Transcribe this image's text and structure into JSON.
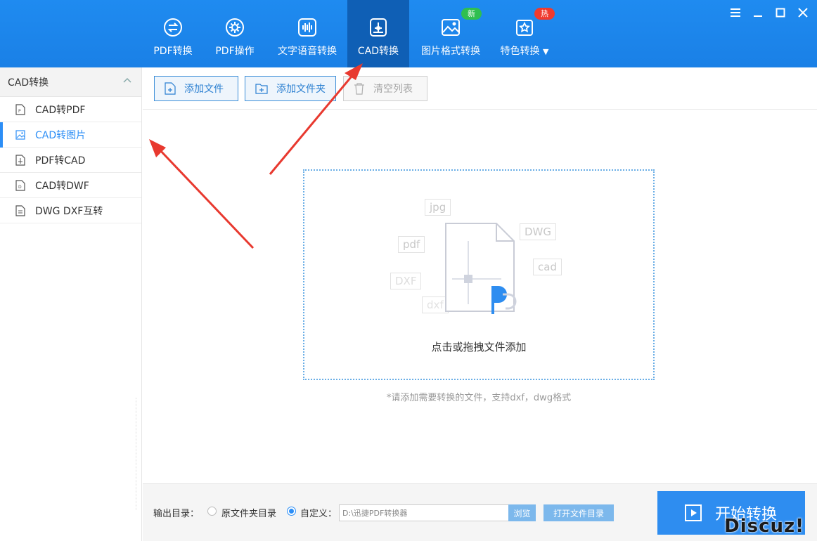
{
  "header": {
    "nav": [
      {
        "label": "PDF转换",
        "icon": "pdf-convert-icon"
      },
      {
        "label": "PDF操作",
        "icon": "gear-circle-icon"
      },
      {
        "label": "文字语音转换",
        "icon": "audio-wave-icon"
      },
      {
        "label": "CAD转换",
        "icon": "cad-icon",
        "active": true
      },
      {
        "label": "图片格式转换",
        "icon": "image-icon",
        "badge": "新"
      },
      {
        "label": "特色转换",
        "icon": "star-icon",
        "badge": "热"
      }
    ],
    "badge_new": "新",
    "badge_hot": "热"
  },
  "sidebar": {
    "title": "CAD转换",
    "items": [
      {
        "label": "CAD转PDF"
      },
      {
        "label": "CAD转图片",
        "active": true
      },
      {
        "label": "PDF转CAD"
      },
      {
        "label": "CAD转DWF"
      },
      {
        "label": "DWG DXF互转"
      }
    ]
  },
  "toolbar": {
    "add_file": "添加文件",
    "add_folder": "添加文件夹",
    "clear_list": "清空列表"
  },
  "dropzone": {
    "text": "点击或拖拽文件添加",
    "tags": [
      "jpg",
      "pdf",
      "DWG",
      "cad",
      "DXF",
      "dxf"
    ],
    "hint": "*请添加需要转换的文件，支持dxf，dwg格式"
  },
  "bottom": {
    "output_label": "输出目录：",
    "option_original": "原文件夹目录",
    "option_custom": "自定义：",
    "path_value": "D:\\迅捷PDF转换器",
    "browse": "浏览",
    "open_dir": "打开文件目录",
    "start": "开始转换"
  },
  "watermark": "Discuz!",
  "colors": {
    "header": "#1a80e6",
    "active_nav": "#0f5fb5",
    "accent": "#2c8ef6",
    "start_button": "#2e8df0",
    "annotation_arrow": "#e8392f"
  }
}
